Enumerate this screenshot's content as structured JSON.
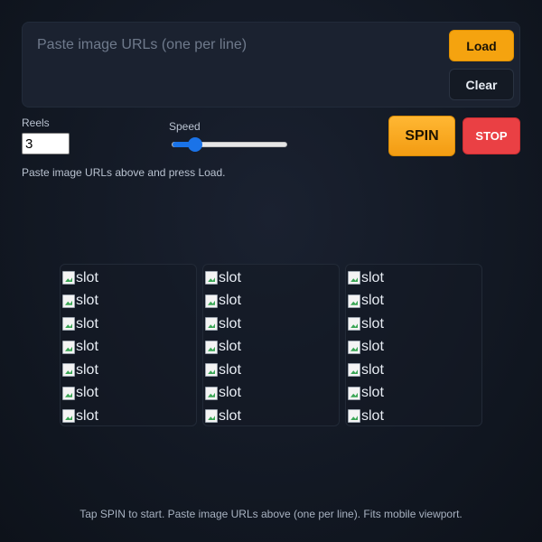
{
  "urls": {
    "placeholder": "Paste image URLs (one per line)",
    "load_label": "Load",
    "clear_label": "Clear"
  },
  "controls": {
    "reels_label": "Reels",
    "reels_value": "3",
    "speed_label": "Speed",
    "speed_fraction": 0.2,
    "spin_label": "SPIN",
    "stop_label": "STOP"
  },
  "status": "Paste image URLs above and press Load.",
  "reels": [
    {
      "slots": [
        "slot",
        "slot",
        "slot",
        "slot",
        "slot",
        "slot",
        "slot"
      ]
    },
    {
      "slots": [
        "slot",
        "slot",
        "slot",
        "slot",
        "slot",
        "slot",
        "slot"
      ]
    },
    {
      "slots": [
        "slot",
        "slot",
        "slot",
        "slot",
        "slot",
        "slot",
        "slot"
      ]
    }
  ],
  "footer": "Tap SPIN to start. Paste image URLs above (one per line). Fits mobile viewport.",
  "colors": {
    "accent": "#f5a30f",
    "stop": "#ea4044",
    "slider": "#1a73e8",
    "background": "#121823"
  }
}
